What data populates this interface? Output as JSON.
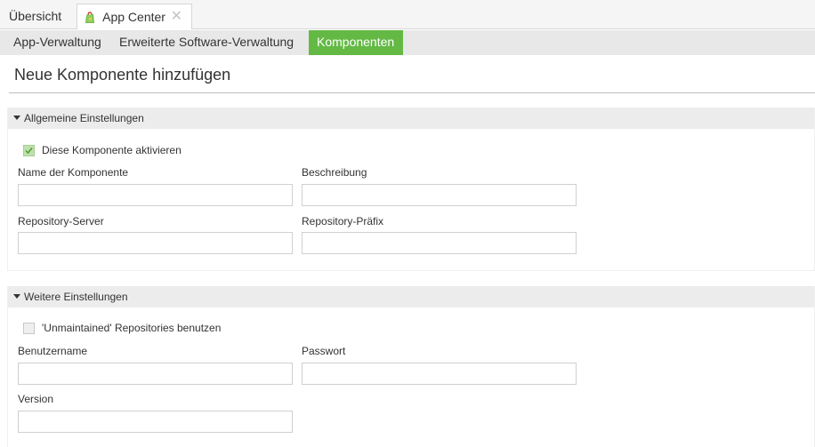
{
  "tabs": {
    "overview_label": "Übersicht",
    "appcenter_label": "App Center",
    "close_symbol": "✕"
  },
  "subtabs": [
    {
      "label": "App-Verwaltung"
    },
    {
      "label": "Erweiterte Software-Verwaltung"
    },
    {
      "label": "Komponenten",
      "active": true
    }
  ],
  "page": {
    "title": "Neue Komponente hinzufügen"
  },
  "general": {
    "header": "Allgemeine Einstellungen",
    "activate_label": "Diese Komponente aktivieren",
    "activate_checked": true,
    "name_label": "Name der Komponente",
    "name_value": "",
    "description_label": "Beschreibung",
    "description_value": "",
    "server_label": "Repository-Server",
    "server_value": "",
    "prefix_label": "Repository-Präfix",
    "prefix_value": ""
  },
  "further": {
    "header": "Weitere Einstellungen",
    "unmaintained_label": "'Unmaintained' Repositories benutzen",
    "unmaintained_checked": false,
    "username_label": "Benutzername",
    "username_value": "",
    "password_label": "Passwort",
    "password_value": "",
    "version_label": "Version",
    "version_value": ""
  },
  "colors": {
    "accent": "#64b945",
    "header_bg": "#ececec",
    "subbar_bg": "#e8e8e8"
  }
}
